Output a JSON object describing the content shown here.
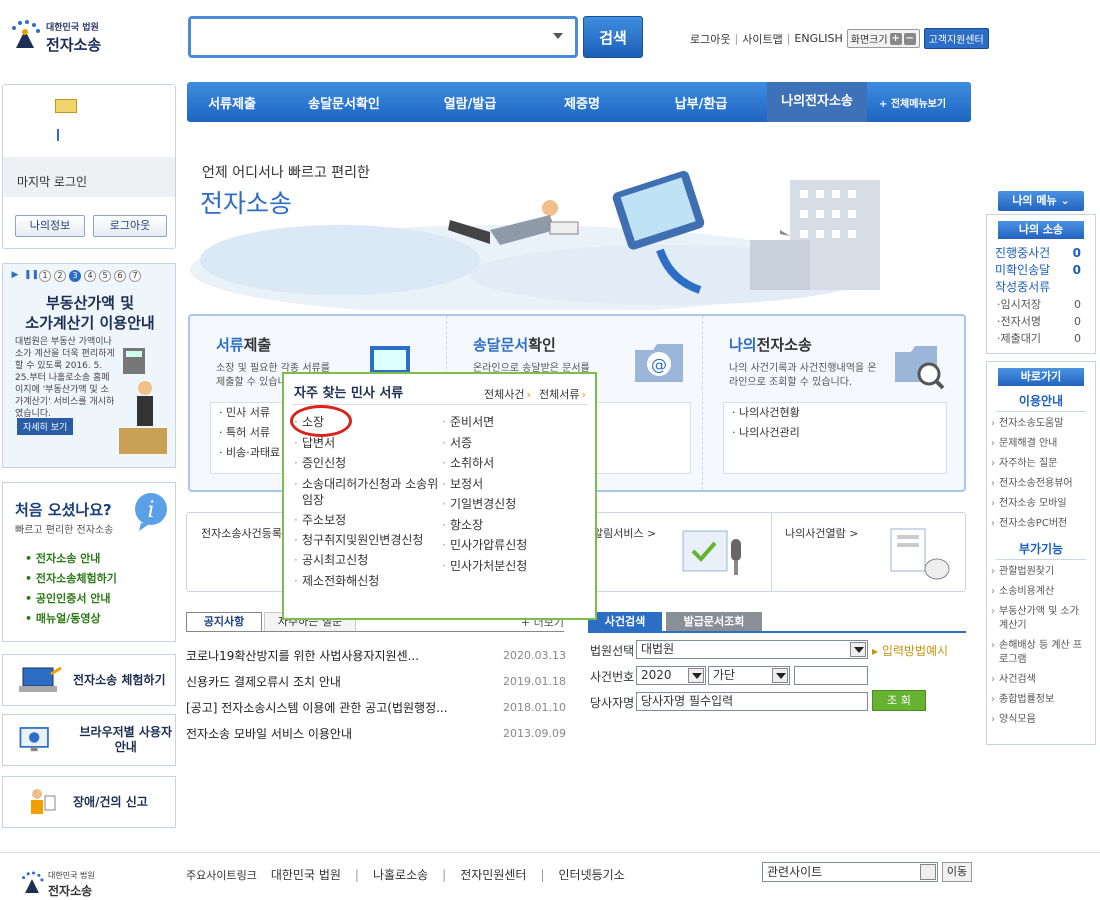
{
  "header": {
    "logo_line1": "대한민국 법원",
    "logo_line2": "전자소송",
    "search_placeholder": "",
    "search_button": "검색",
    "links": [
      "로그아웃",
      "사이트맵",
      "ENGLISH"
    ],
    "zoom_label": "화면크기",
    "help_center": "고객지원센터"
  },
  "gnb": {
    "items": [
      "서류제출",
      "송달문서확인",
      "열람/발급",
      "제증명",
      "납부/환급",
      "나의전자소송"
    ],
    "all_menu": "+ 전체메뉴보기"
  },
  "login": {
    "last_login": "마지막 로그인",
    "my_info": "나의정보",
    "logout": "로그아웃"
  },
  "banner": {
    "pages": [
      "1",
      "2",
      "3",
      "4",
      "5",
      "6",
      "7"
    ],
    "title1": "부동산가액 및",
    "title2": "소가계산기 이용안내",
    "text": "대법원은 부동산 가액이나 소가 계산을 더욱 편리하게 할 수 있도록 2016. 5. 25.부터 나홀로소송 홈페이지에 '부동산가액 및 소가계산기' 서비스를 개시하였습니다.",
    "more": "자세히 보기"
  },
  "first_visit": {
    "title": "처음 오셨나요?",
    "subtitle": "빠르고 편리한 전자소송",
    "items": [
      "전자소송 안내",
      "전자소송체험하기",
      "공인인증서 안내",
      "매뉴얼/동영상"
    ]
  },
  "quick_buttons": [
    "전자소송 체험하기",
    "브라우저별 사용자안내",
    "장애/건의 신고"
  ],
  "hero": {
    "line1": "언제 어디서나 빠르고 편리한",
    "line2": "전자소송"
  },
  "services": {
    "doc": {
      "title_em": "서류",
      "title": "제출",
      "desc": "소장 및 필요한 각종 서류를 제출할 수 있습니다",
      "list": [
        "민사 서류",
        "특허 서류",
        "비송·과태료"
      ]
    },
    "delivery": {
      "title_em": "송달문서",
      "title": "확인",
      "desc": "온라인으로 송달받은 문서를",
      "list": []
    },
    "mine": {
      "title_em": "나의",
      "title": "전자소송",
      "desc": "나의 사건기록과 사건진행내역을 온라인으로 조회할 수 있습니다.",
      "list": [
        "나의사건현황",
        "나의사건관리"
      ]
    }
  },
  "row2": {
    "item1": "전자소송사건등록",
    "item2": "알림서비스 >",
    "item3": "나의사건열람 >"
  },
  "popup": {
    "title": "자주 찾는 민사 서류",
    "link_all_cases": "전체사건",
    "link_all_docs": "전체서류",
    "left": [
      "소장",
      "답변서",
      "증인신청",
      "소송대리허가신청과 소송위임장",
      "주소보정",
      "청구취지및원인변경신청",
      "공시최고신청",
      "제소전화해신청"
    ],
    "right": [
      "준비서면",
      "서증",
      "소취하서",
      "보정서",
      "기일변경신청",
      "항소장",
      "민사가압류신청",
      "민사가처분신청"
    ]
  },
  "notice": {
    "tabs": [
      "공지사항",
      "자주하는 질문"
    ],
    "more": "더보기",
    "rows": [
      {
        "title": "코로나19확산방지를 위한 사법사용자지원센...",
        "date": "2020.03.13"
      },
      {
        "title": "신용카드 결제오류시 조치 안내",
        "date": "2019.01.18"
      },
      {
        "title": "[공고] 전자소송시스템 이용에 관한 공고(법원행정...",
        "date": "2018.01.10"
      },
      {
        "title": "전자소송 모바일 서비스 이용안내",
        "date": "2013.09.09"
      }
    ]
  },
  "case_search": {
    "tabs": [
      "사건검색",
      "발급문서조회"
    ],
    "court_label": "법원선택",
    "court_value": "대법원",
    "input_help": "입력방법예시",
    "case_no_label": "사건번호",
    "year": "2020",
    "type": "가단",
    "party_label": "당사자명",
    "party_placeholder": "당사자명 필수입력",
    "submit": "조 회"
  },
  "right": {
    "my_menu": "나의 메뉴",
    "my_suit": "나의 소송",
    "counts": [
      {
        "label": "진행중사건",
        "value": "0"
      },
      {
        "label": "미확인송달",
        "value": "0"
      },
      {
        "label": "작성중서류",
        "value": ""
      }
    ],
    "sub_counts": [
      {
        "label": "임시저장",
        "value": "0"
      },
      {
        "label": "전자서명",
        "value": "0"
      },
      {
        "label": "제출대기",
        "value": "0"
      }
    ],
    "shortcut": "바로가기",
    "guide_title": "이용안내",
    "guide": [
      "전자소송도움말",
      "문제해결 안내",
      "자주하는 질문",
      "전자소송전용뷰어",
      "전자소송 모바일",
      "전자소송PC버전"
    ],
    "extra_title": "부가기능",
    "extra": [
      "관할법원찾기",
      "소송비용계산",
      "부동산가액 및 소가계산기",
      "손해배상 등 계산 프로그램",
      "사건검색",
      "종합법률정보",
      "양식모음"
    ]
  },
  "footer": {
    "links": [
      "주요사이트링크",
      "대한민국 법원",
      "나홀로소송",
      "전자민원센터",
      "인터넷등기소"
    ],
    "related": "관련사이트",
    "go": "이동"
  }
}
